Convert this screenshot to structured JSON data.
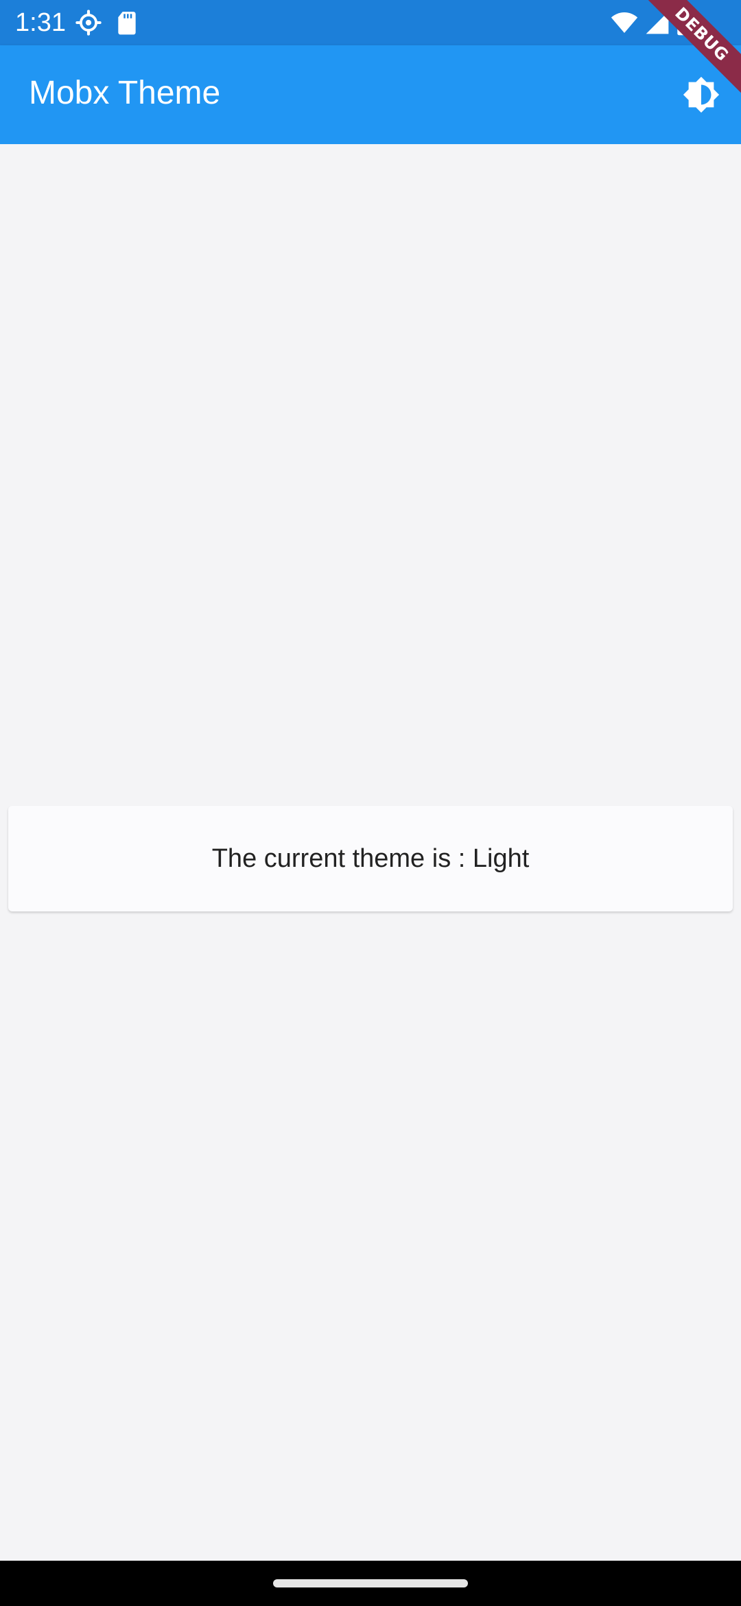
{
  "status_bar": {
    "time": "1:31",
    "icons": [
      "gear-icon",
      "sd-card-icon",
      "wifi-icon",
      "signal-icon",
      "battery-icon"
    ]
  },
  "app_bar": {
    "title": "Mobx Theme",
    "action_icon": "brightness-icon",
    "background": "#2196f3"
  },
  "debug_banner": {
    "label": "DEBUG"
  },
  "main": {
    "theme_text": "The current theme is : Light"
  },
  "colors": {
    "status_bar": "#1c7fd9",
    "app_bar": "#2196f3",
    "background": "#f4f4f6",
    "card": "#fbfbfd",
    "banner": "#8b2b48"
  }
}
